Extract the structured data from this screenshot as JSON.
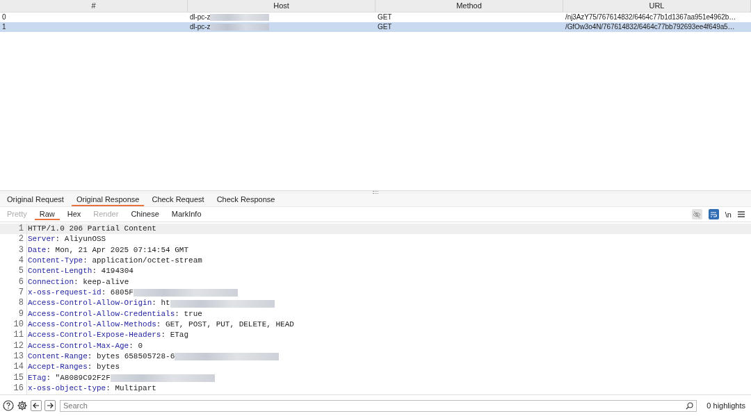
{
  "table": {
    "columns": [
      "#",
      "Host",
      "Method",
      "URL"
    ],
    "rows": [
      {
        "cells": [
          "0",
          "dl-pc-z",
          "GET",
          "/nj3AzY75/767614832/6464c77b1d1367aa951e4962b…"
        ],
        "blurred": true,
        "selected": false
      },
      {
        "cells": [
          "1",
          "dl-pc-z",
          "GET",
          "/GfOw3o4N/767614832/6464c77bb792693ee4f649a5…"
        ],
        "blurred": true,
        "selected": true
      }
    ]
  },
  "tabs": [
    {
      "label": "Original Request",
      "selected": false
    },
    {
      "label": "Original Response",
      "selected": true
    },
    {
      "label": "Check Request",
      "selected": false
    },
    {
      "label": "Check Response",
      "selected": false
    }
  ],
  "view_tabs": [
    {
      "label": "Pretty",
      "selected": false,
      "disabled": true
    },
    {
      "label": "Raw",
      "selected": true,
      "disabled": false
    },
    {
      "label": "Hex",
      "selected": false,
      "disabled": false
    },
    {
      "label": "Render",
      "selected": false,
      "disabled": true
    },
    {
      "label": "Chinese",
      "selected": false,
      "disabled": false
    },
    {
      "label": "MarkInfo",
      "selected": false,
      "disabled": false
    }
  ],
  "toolbar": {
    "hide_toggle_on": false,
    "wrap_toggle_on": true,
    "newline_label": "\\n"
  },
  "lines": [
    {
      "num": "1",
      "kind": "status",
      "value": "HTTP/1.0 206 Partial Content",
      "blurred": false,
      "current": true
    },
    {
      "num": "2",
      "kind": "header",
      "key": "Server",
      "value": ": AliyunOSS",
      "blurred": false,
      "current": false
    },
    {
      "num": "3",
      "kind": "header",
      "key": "Date",
      "value": ": Mon, 21 Apr 2025 07:14:54 GMT",
      "blurred": false,
      "current": false
    },
    {
      "num": "4",
      "kind": "header",
      "key": "Content-Type",
      "value": ": application/octet-stream",
      "blurred": false,
      "current": false
    },
    {
      "num": "5",
      "kind": "header",
      "key": "Content-Length",
      "value": ": 4194304",
      "blurred": false,
      "current": false
    },
    {
      "num": "6",
      "kind": "header",
      "key": "Connection",
      "value": ": keep-alive",
      "blurred": false,
      "current": false
    },
    {
      "num": "7",
      "kind": "header",
      "key": "x-oss-request-id",
      "value": ": 6805F",
      "blurred": true,
      "current": false
    },
    {
      "num": "8",
      "kind": "header",
      "key": "Access-Control-Allow-Origin",
      "value": ": ht",
      "blurred": true,
      "current": false
    },
    {
      "num": "9",
      "kind": "header",
      "key": "Access-Control-Allow-Credentials",
      "value": ": true",
      "blurred": false,
      "current": false
    },
    {
      "num": "10",
      "kind": "header",
      "key": "Access-Control-Allow-Methods",
      "value": ": GET, POST, PUT, DELETE, HEAD",
      "blurred": false,
      "current": false
    },
    {
      "num": "11",
      "kind": "header",
      "key": "Access-Control-Expose-Headers",
      "value": ": ETag",
      "blurred": false,
      "current": false
    },
    {
      "num": "12",
      "kind": "header",
      "key": "Access-Control-Max-Age",
      "value": ": 0",
      "blurred": false,
      "current": false
    },
    {
      "num": "13",
      "kind": "header",
      "key": "Content-Range",
      "value": ": bytes 658505728-6",
      "blurred": true,
      "current": false
    },
    {
      "num": "14",
      "kind": "header",
      "key": "Accept-Ranges",
      "value": ": bytes",
      "blurred": false,
      "current": false
    },
    {
      "num": "15",
      "kind": "header",
      "key": "ETag",
      "value": ": \"A8089C92F2F",
      "blurred": true,
      "current": false
    },
    {
      "num": "16",
      "kind": "header",
      "key": "x-oss-object-type",
      "value": ": Multipart",
      "blurred": false,
      "current": false
    }
  ],
  "search": {
    "placeholder": "Search",
    "result": "0 highlights"
  }
}
